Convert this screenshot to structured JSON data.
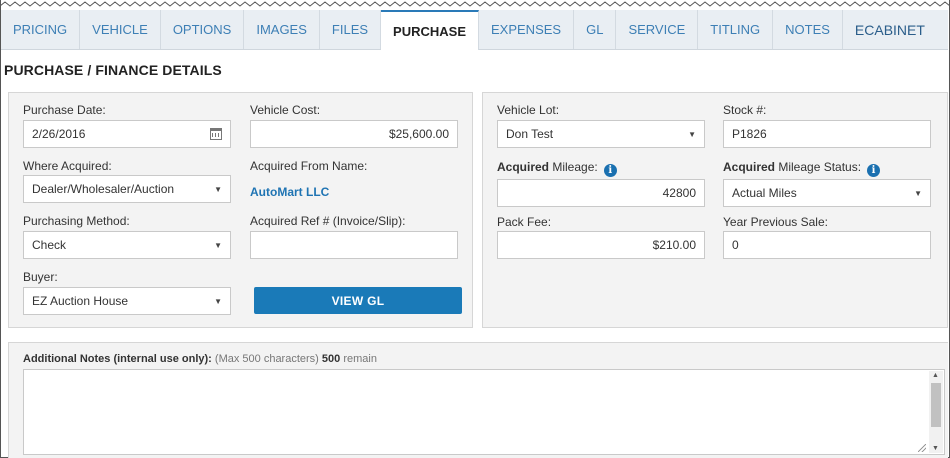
{
  "tabs": [
    {
      "label": "PRICING"
    },
    {
      "label": "VEHICLE"
    },
    {
      "label": "OPTIONS"
    },
    {
      "label": "IMAGES"
    },
    {
      "label": "FILES"
    },
    {
      "label": "PURCHASE"
    },
    {
      "label": "EXPENSES"
    },
    {
      "label": "GL"
    },
    {
      "label": "SERVICE"
    },
    {
      "label": "TITLING"
    },
    {
      "label": "NOTES"
    },
    {
      "label": "ECABINET"
    }
  ],
  "active_tab": "PURCHASE",
  "section_title": "PURCHASE / FINANCE DETAILS",
  "left": {
    "purchase_date": {
      "label": "Purchase Date:",
      "value": "2/26/2016"
    },
    "vehicle_cost": {
      "label": "Vehicle Cost:",
      "value": "$25,600.00"
    },
    "where_acquired": {
      "label": "Where Acquired:",
      "value": "Dealer/Wholesaler/Auction"
    },
    "acquired_from": {
      "label": "Acquired From Name:",
      "value": "AutoMart LLC"
    },
    "purchasing_method": {
      "label": "Purchasing Method:",
      "value": "Check"
    },
    "acquired_ref": {
      "label": "Acquired Ref # (Invoice/Slip):",
      "value": ""
    },
    "buyer": {
      "label": "Buyer:",
      "value": "EZ Auction House"
    },
    "view_gl": "VIEW GL"
  },
  "right": {
    "vehicle_lot": {
      "label": "Vehicle Lot:",
      "value": "Don Test"
    },
    "stock": {
      "label": "Stock #:",
      "value": "P1826"
    },
    "acquired_mileage": {
      "label_bold": "Acquired",
      "label_rest": " Mileage:",
      "value": "42800"
    },
    "mileage_status": {
      "label_bold": "Acquired",
      "label_rest": " Mileage Status:",
      "value": "Actual Miles"
    },
    "pack_fee": {
      "label": "Pack Fee:",
      "value": "$210.00"
    },
    "year_prev_sale": {
      "label": "Year Previous Sale:",
      "value": "0"
    }
  },
  "notes": {
    "label_strong": "Additional Notes",
    "label_mid": " (internal use only):",
    "label_hint": " (Max 500 characters) ",
    "remain_count": "500",
    "remain_word": " remain",
    "value": ""
  },
  "colors": {
    "accent": "#1a7ab8",
    "tab_text": "#3d7fb5",
    "panel_bg": "#f3f3f3"
  }
}
